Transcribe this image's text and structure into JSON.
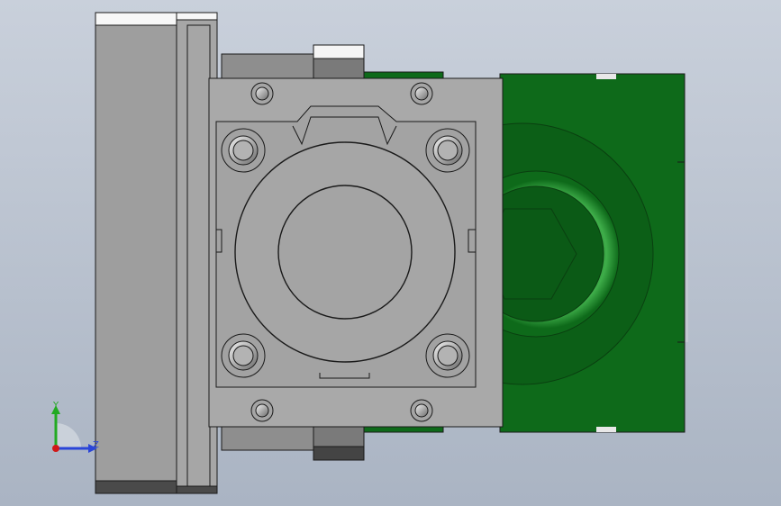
{
  "viewport": {
    "background_top": "#c9d0db",
    "background_bottom": "#aab4c3"
  },
  "model": {
    "body_color": "#9c9c9c",
    "flange_color": "#a8a8a8",
    "green_color": "#0e6a1a",
    "green_dark": "#0a4d13",
    "edge_color": "#1a1a1a"
  },
  "triad": {
    "y_label": "Y",
    "z_label": "Z",
    "y_color": "#22aa22",
    "z_color": "#2a45d8",
    "origin_color": "#d01818"
  }
}
